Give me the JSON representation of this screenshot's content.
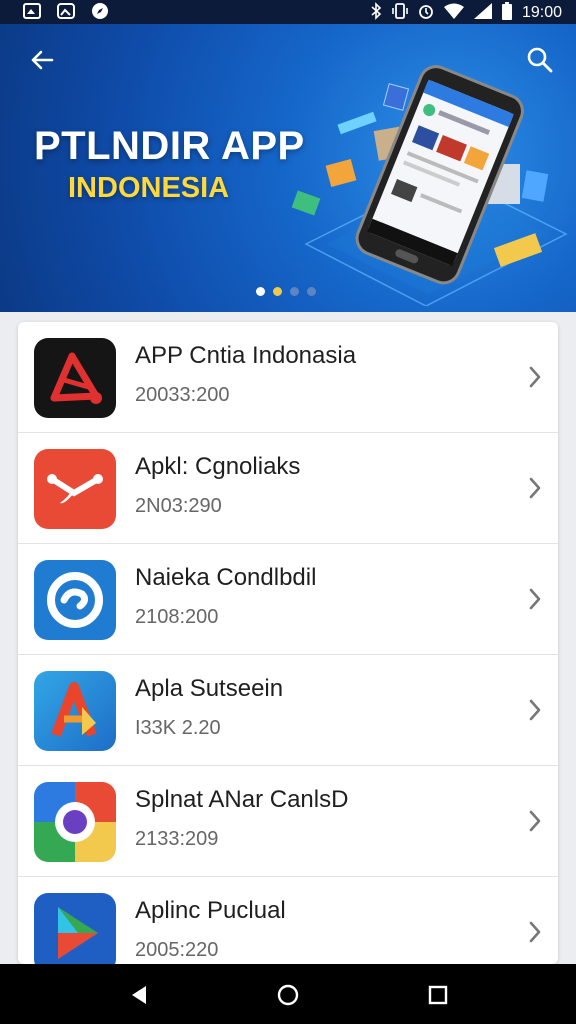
{
  "status_bar": {
    "time": "19:00"
  },
  "hero": {
    "title": "PTLNDIR APP",
    "subtitle": "INDONESIA",
    "carousel": {
      "count": 4,
      "active_index": 0
    }
  },
  "apps": [
    {
      "title": "APP Cntia Indonasia",
      "subtitle": "20033:200",
      "icon": "red-triangle-app-icon"
    },
    {
      "title": "Apkl: Cgnoliaks",
      "subtitle": "2N03:290",
      "icon": "red-scissors-app-icon"
    },
    {
      "title": "Naieka Condlbdil",
      "subtitle": "2108:200",
      "icon": "blue-swirl-app-icon"
    },
    {
      "title": "Apla Sutseein",
      "subtitle": "I33K 2.20",
      "icon": "blue-a-logo-app-icon"
    },
    {
      "title": "Splnat ANar CanlsD",
      "subtitle": "2133:209",
      "icon": "multicolor-ring-app-icon"
    },
    {
      "title": "Aplinc Puclual",
      "subtitle": "2005:220",
      "icon": "play-triangle-app-icon"
    }
  ],
  "colors": {
    "hero_blue": "#1566c9",
    "accent_yellow": "#ffd93b",
    "statusbar": "#0d1b3a",
    "navbar": "#000000"
  }
}
